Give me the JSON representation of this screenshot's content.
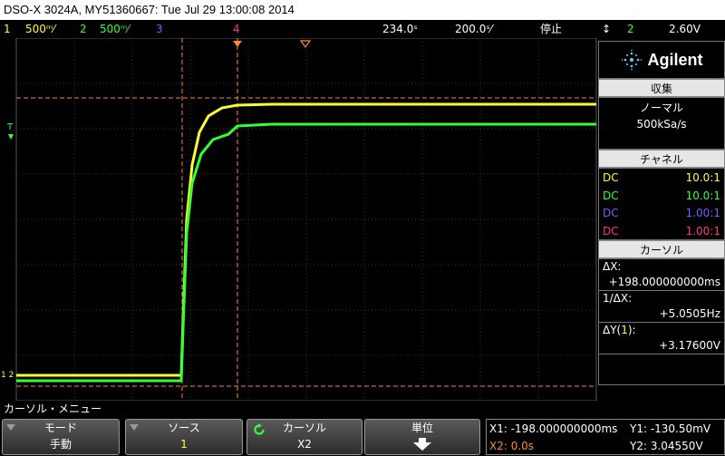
{
  "title": "DSO-X 3024A, MY51360667: Tue Jul 29 13:00:08 2014",
  "status": {
    "ch1_num": "1",
    "ch1_scale": "500ᵐ⁄",
    "ch2_num": "2",
    "ch2_scale": "500ᵐ⁄",
    "ch3_num": "3",
    "ch4_num": "4",
    "delay": "234.0ˢ",
    "timebase": "200.0ˢ⁄",
    "run_state": "停止",
    "trig_num": "2",
    "trig_level": "2.60V"
  },
  "markers": {
    "trigger_label": "T",
    "ground_label": "1 2"
  },
  "panel": {
    "brand": "Agilent",
    "acq_header": "収集",
    "acq_mode": "ノーマル",
    "acq_rate": "500kSa/s",
    "channels_header": "チャネル",
    "channels": [
      {
        "coupling": "DC",
        "probe": "10.0:1",
        "color": "#ffff33"
      },
      {
        "coupling": "DC",
        "probe": "10.0:1",
        "color": "#33ff33"
      },
      {
        "coupling": "DC",
        "probe": "1.00:1",
        "color": "#6666ff"
      },
      {
        "coupling": "DC",
        "probe": "1.00:1",
        "color": "#ff3388"
      }
    ],
    "cursors_header": "カーソル",
    "dx_label": "ΔX:",
    "dx_value": "+198.000000000ms",
    "inv_dx_label": "1/ΔX:",
    "inv_dx_value": "+5.0505Hz",
    "dy_label_a": "ΔY(",
    "dy_label_ch": "1",
    "dy_label_b": "):",
    "dy_value": "+3.17600V"
  },
  "menu_title": "カーソル・メニュー",
  "softkeys": {
    "mode_label": "モード",
    "mode_value": "手動",
    "source_label": "ソース",
    "source_value": "1",
    "cursors_label": "カーソル",
    "cursors_value": "X2",
    "units_label": "単位"
  },
  "readout": {
    "x1": "X1: -198.000000000ms",
    "x2": "X2: 0.0s",
    "y1": "Y1: -130.50mV",
    "y2": "Y2: 3.04550V"
  },
  "colors": {
    "ch1": "#ffff33",
    "ch2": "#33ff33",
    "ch3": "#6666ff",
    "ch4": "#ff3388",
    "cursor": "#ff8833"
  }
}
